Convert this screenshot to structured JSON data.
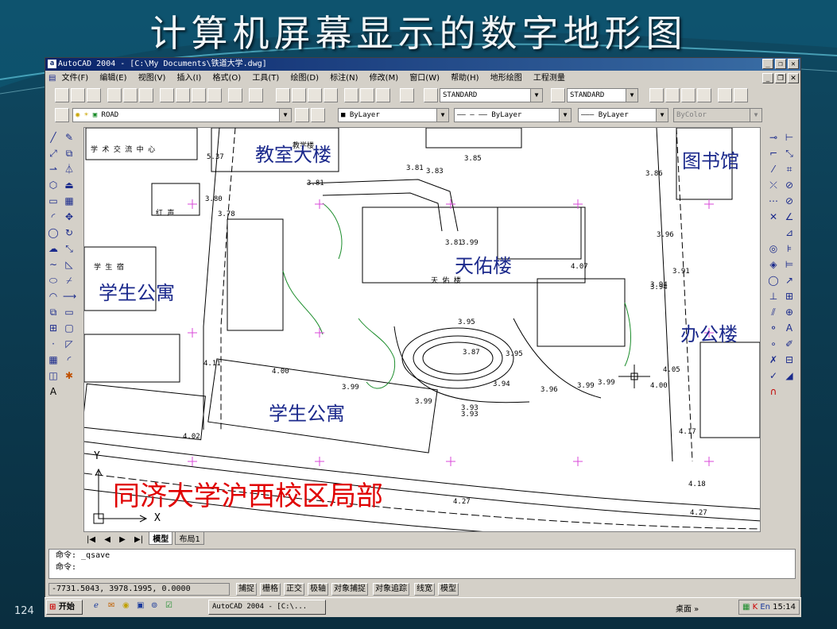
{
  "slide": {
    "title": "计算机屏幕显示的数字地形图",
    "page_number": "124"
  },
  "window": {
    "title": "AutoCAD 2004 - [C:\\My Documents\\铁道大学.dwg]"
  },
  "menu": [
    "文件(F)",
    "编辑(E)",
    "视图(V)",
    "插入(I)",
    "格式(O)",
    "工具(T)",
    "绘图(D)",
    "标注(N)",
    "修改(M)",
    "窗口(W)",
    "帮助(H)",
    "地形绘图",
    "工程测量"
  ],
  "toolbar": {
    "text_style": "STANDARD",
    "dim_style": "STANDARD",
    "layer": "ROAD",
    "color": "ByLayer",
    "linetype": "ByLayer",
    "lineweight": "ByLayer",
    "plotstyle": "ByColor"
  },
  "map": {
    "labels": [
      "教室大楼",
      "图书馆",
      "天佑楼",
      "学生公寓",
      "办公楼",
      "学生公寓"
    ],
    "caption": "同济大学沪西校区局部",
    "small_labels": [
      "学 术 交 流 中 心",
      "教学楼",
      "5.37",
      "3.85",
      "3.81",
      "3.83",
      "3.81",
      "3.80",
      "3.78",
      "3.86",
      "3.96",
      "3.99",
      "4.07",
      "3.94",
      "3.81",
      "天 佑 楼",
      "3.95",
      "3.87",
      "3.95",
      "3.94",
      "3.96",
      "4.00",
      "4.11",
      "4.00",
      "3.99",
      "3.99",
      "3.93",
      "4.02",
      "4.27",
      "4.27",
      "4.18",
      "4.17",
      "4.05",
      "3.99",
      "3.93",
      "3.91",
      "3.94",
      "3.99",
      "红 声",
      "学 生 宿"
    ],
    "axis_y": "Y",
    "axis_x": "X"
  },
  "tabs": [
    "模型",
    "布局1"
  ],
  "command": {
    "line1": "命令: _qsave",
    "line2": "命令:"
  },
  "status": {
    "coords": "-7731.5043, 3978.1995, 0.0000",
    "buttons": [
      "捕捉",
      "栅格",
      "正交",
      "极轴",
      "对象捕捉",
      "对象追踪",
      "线宽",
      "模型"
    ]
  },
  "taskbar": {
    "start": "开始",
    "task": "AutoCAD 2004 - [C:\\...",
    "desktop": "桌面 »",
    "time": "15:14"
  }
}
